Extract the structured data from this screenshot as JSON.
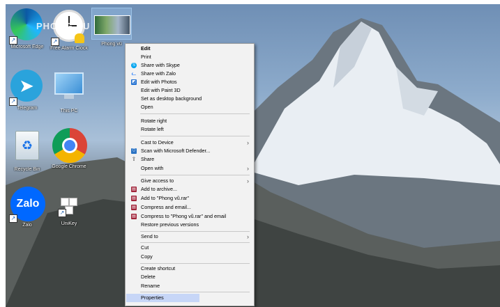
{
  "desktop_icons": [
    {
      "label": "Microsoft Edge",
      "icon": "edge-icon"
    },
    {
      "label": "Free Alarm Clock",
      "icon": "alarm-clock-icon"
    },
    {
      "label": "Phong vũ",
      "icon": "photo-thumbnail-icon"
    },
    {
      "label": "Telegram",
      "icon": "telegram-icon"
    },
    {
      "label": "This PC",
      "icon": "computer-icon"
    },
    {
      "label": "Recycle Bin",
      "icon": "recycle-bin-icon"
    },
    {
      "label": "Google Chrome",
      "icon": "chrome-icon"
    },
    {
      "label": "Zalo",
      "icon": "zalo-icon",
      "glyph_text": "Zalo"
    },
    {
      "label": "UniKey",
      "icon": "unikey-icon"
    }
  ],
  "watermark": "PHONG VU",
  "context_menu": {
    "items": [
      {
        "label": "Edit"
      },
      {
        "label": "Print"
      },
      {
        "label": "Share with Skype",
        "icon": "skype-icon"
      },
      {
        "label": "Share with Zalo",
        "icon": "zalo-small-icon"
      },
      {
        "label": "Edit with Photos",
        "icon": "photos-icon"
      },
      {
        "label": "Edit with Paint 3D"
      },
      {
        "label": "Set as desktop background"
      },
      {
        "label": "Open"
      },
      {
        "label": "Rotate right"
      },
      {
        "label": "Rotate left"
      },
      {
        "label": "Cast to Device"
      },
      {
        "label": "Scan with Microsoft Defender...",
        "icon": "defender-icon"
      },
      {
        "label": "Share",
        "icon": "share-icon"
      },
      {
        "label": "Open with"
      },
      {
        "label": "Give access to"
      },
      {
        "label": "Add to archive...",
        "icon": "winrar-icon"
      },
      {
        "label": "Add to \"Phong vũ.rar\"",
        "icon": "winrar-icon"
      },
      {
        "label": "Compress and email...",
        "icon": "winrar-icon"
      },
      {
        "label": "Compress to \"Phong vũ.rar\" and email",
        "icon": "winrar-icon"
      },
      {
        "label": "Restore previous versions"
      },
      {
        "label": "Send to"
      },
      {
        "label": "Cut"
      },
      {
        "label": "Copy"
      },
      {
        "label": "Create shortcut"
      },
      {
        "label": "Delete"
      },
      {
        "label": "Rename"
      },
      {
        "label": "Properties"
      }
    ],
    "submenu_indicator": "›"
  },
  "colors": {
    "highlight": "#c7d6f7",
    "menu_bg": "#f2f2f2"
  }
}
